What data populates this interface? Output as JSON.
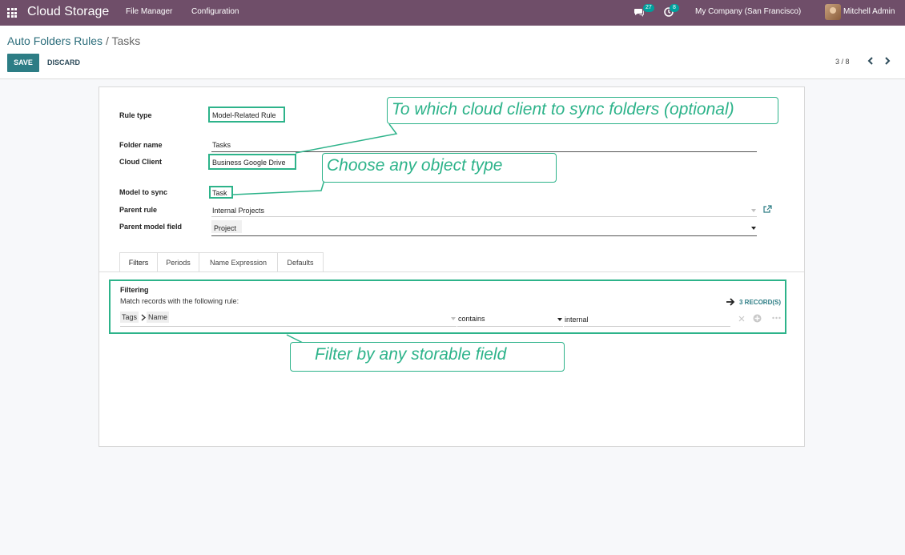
{
  "navbar": {
    "brand": "Cloud Storage",
    "menu": [
      "File Manager",
      "Configuration"
    ],
    "messages_count": "27",
    "activities_count": "8",
    "company": "My Company (San Francisco)",
    "user": "Mitchell Admin"
  },
  "control": {
    "breadcrumb_parent": "Auto Folders Rules",
    "breadcrumb_sep": "/",
    "breadcrumb_current": "Tasks",
    "save_label": "SAVE",
    "discard_label": "DISCARD",
    "pager": "3 / 8"
  },
  "form": {
    "rule_type_label": "Rule type",
    "rule_type_value": "Model-Related Rule",
    "folder_name_label": "Folder name",
    "folder_name_value": "Tasks",
    "cloud_client_label": "Cloud Client",
    "cloud_client_value": "Business Google Drive",
    "model_label": "Model to sync",
    "model_value": "Task",
    "parent_rule_label": "Parent rule",
    "parent_rule_value": "Internal Projects",
    "parent_field_label": "Parent model field",
    "parent_field_value": "Project"
  },
  "tabs": [
    "Filters",
    "Periods",
    "Name Expression",
    "Defaults"
  ],
  "filters": {
    "title": "Filtering",
    "subtitle": "Match records with the following rule:",
    "records": "3 RECORD(S)",
    "path_1": "Tags",
    "path_2": "Name",
    "operator": "contains",
    "value": "internal"
  },
  "callouts": {
    "cloud_client": "To which cloud client to sync folders (optional)",
    "object_type": "Choose any object type",
    "storable_field": "Filter by any storable field"
  },
  "colors": {
    "navbar": "#6f4e69",
    "primary": "#2d7d85",
    "highlight": "#2db38a"
  }
}
